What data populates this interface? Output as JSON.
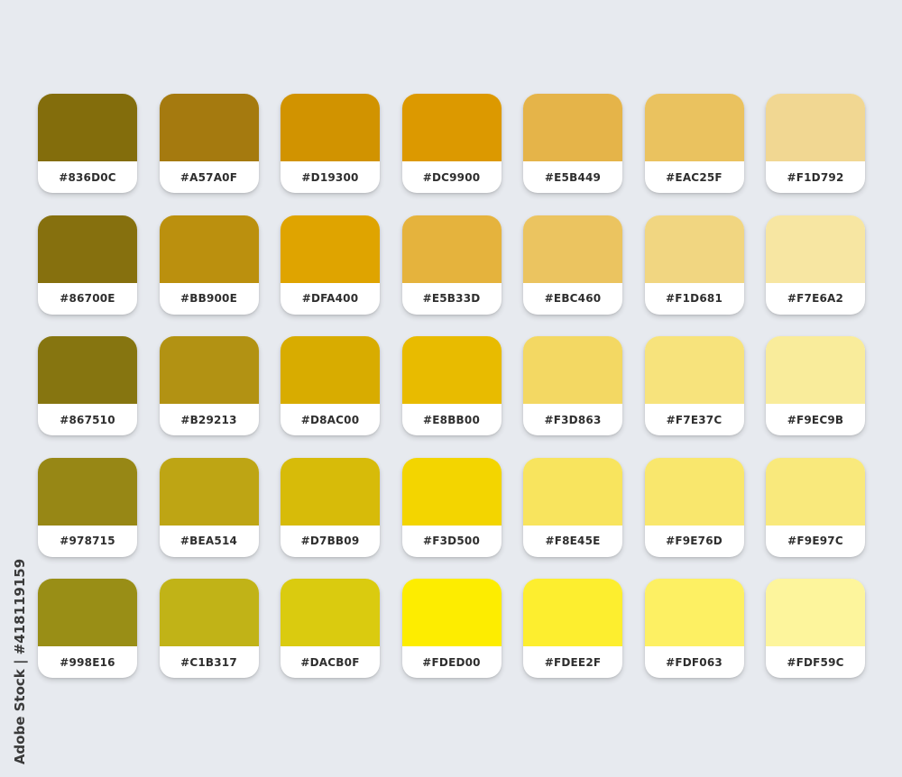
{
  "palette": [
    {
      "hex": "#836D0C",
      "label": "#836D0C"
    },
    {
      "hex": "#A57A0F",
      "label": "#A57A0F"
    },
    {
      "hex": "#D19300",
      "label": "#D19300"
    },
    {
      "hex": "#DC9900",
      "label": "#DC9900"
    },
    {
      "hex": "#E5B449",
      "label": "#E5B449"
    },
    {
      "hex": "#EAC25F",
      "label": "#EAC25F"
    },
    {
      "hex": "#F1D792",
      "label": "#F1D792"
    },
    {
      "hex": "#86700E",
      "label": "#86700E"
    },
    {
      "hex": "#BB900E",
      "label": "#BB900E"
    },
    {
      "hex": "#DFA400",
      "label": "#DFA400"
    },
    {
      "hex": "#E5B33D",
      "label": "#E5B33D"
    },
    {
      "hex": "#EBC460",
      "label": "#EBC460"
    },
    {
      "hex": "#F1D681",
      "label": "#F1D681"
    },
    {
      "hex": "#F7E6A2",
      "label": "#F7E6A2"
    },
    {
      "hex": "#867510",
      "label": "#867510"
    },
    {
      "hex": "#B29213",
      "label": "#B29213"
    },
    {
      "hex": "#D8AC00",
      "label": "#D8AC00"
    },
    {
      "hex": "#E8BB00",
      "label": "#E8BB00"
    },
    {
      "hex": "#F3D863",
      "label": "#F3D863"
    },
    {
      "hex": "#F7E37C",
      "label": "#F7E37C"
    },
    {
      "hex": "#F9EC9B",
      "label": "#F9EC9B"
    },
    {
      "hex": "#978715",
      "label": "#978715"
    },
    {
      "hex": "#BEA514",
      "label": "#BEA514"
    },
    {
      "hex": "#D7BB09",
      "label": "#D7BB09"
    },
    {
      "hex": "#F3D500",
      "label": "#F3D500"
    },
    {
      "hex": "#F8E45E",
      "label": "#F8E45E"
    },
    {
      "hex": "#F9E76D",
      "label": "#F9E76D"
    },
    {
      "hex": "#F9E97C",
      "label": "#F9E97C"
    },
    {
      "hex": "#998E16",
      "label": "#998E16"
    },
    {
      "hex": "#C1B317",
      "label": "#C1B317"
    },
    {
      "hex": "#DACB0F",
      "label": "#DACB0F"
    },
    {
      "hex": "#FDED00",
      "label": "#FDED00"
    },
    {
      "hex": "#FDEE2F",
      "label": "#FDEE2F"
    },
    {
      "hex": "#FDF063",
      "label": "#FDF063"
    },
    {
      "hex": "#FDF59C",
      "label": "#FDF59C"
    }
  ],
  "watermark": {
    "id_text": "Adobe Stock | #418119159"
  }
}
